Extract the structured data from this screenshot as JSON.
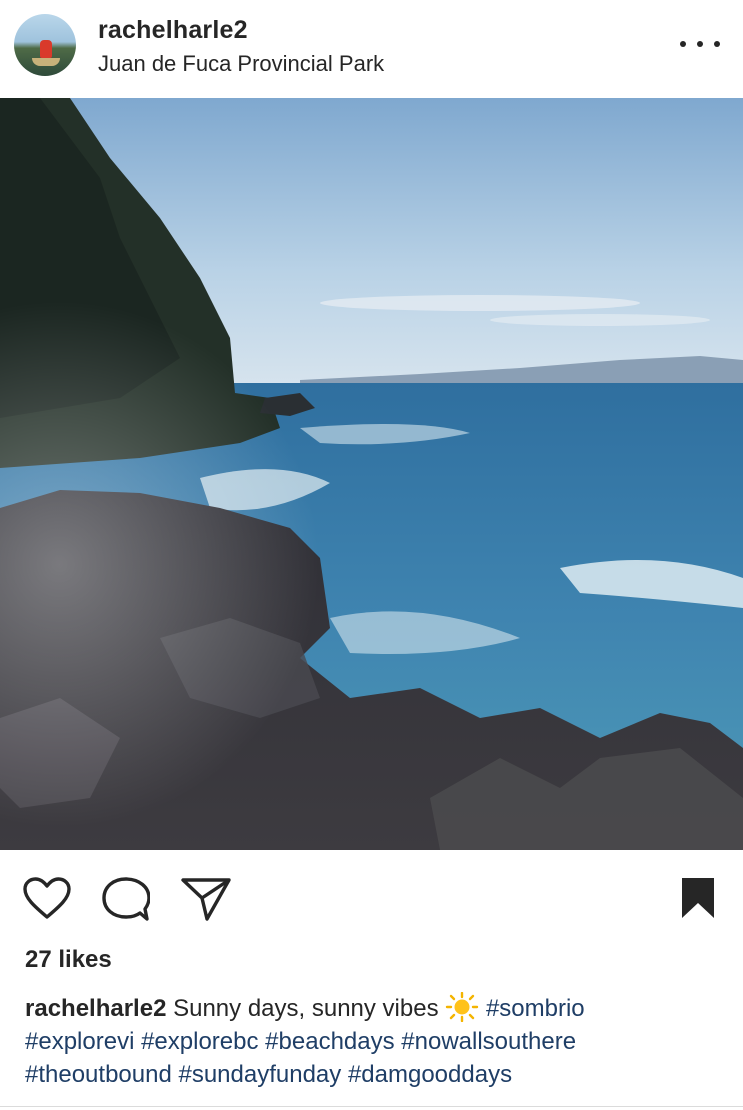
{
  "post": {
    "username": "rachelharle2",
    "location": "Juan de Fuca Provincial Park",
    "image_alt": "Rocky shoreline with forested cliff overlooking the ocean on a sunny day",
    "likes": "27 likes",
    "caption": {
      "author": "rachelharle2",
      "text": "Sunny days, sunny vibes",
      "emoji": "sun-emoji",
      "hashtags": [
        "#sombrio",
        "#explorevi",
        "#explorebc",
        "#beachdays",
        "#nowallsouthere",
        "#theoutbound",
        "#sundayfunday",
        "#damgooddays"
      ]
    }
  },
  "icons": {
    "more": "more-options-icon",
    "like": "heart-icon",
    "comment": "comment-icon",
    "share": "paper-plane-icon",
    "save": "bookmark-icon"
  },
  "colors": {
    "text": "#262626",
    "hashtag": "#1f3e66",
    "divider": "#dbdbdb"
  }
}
